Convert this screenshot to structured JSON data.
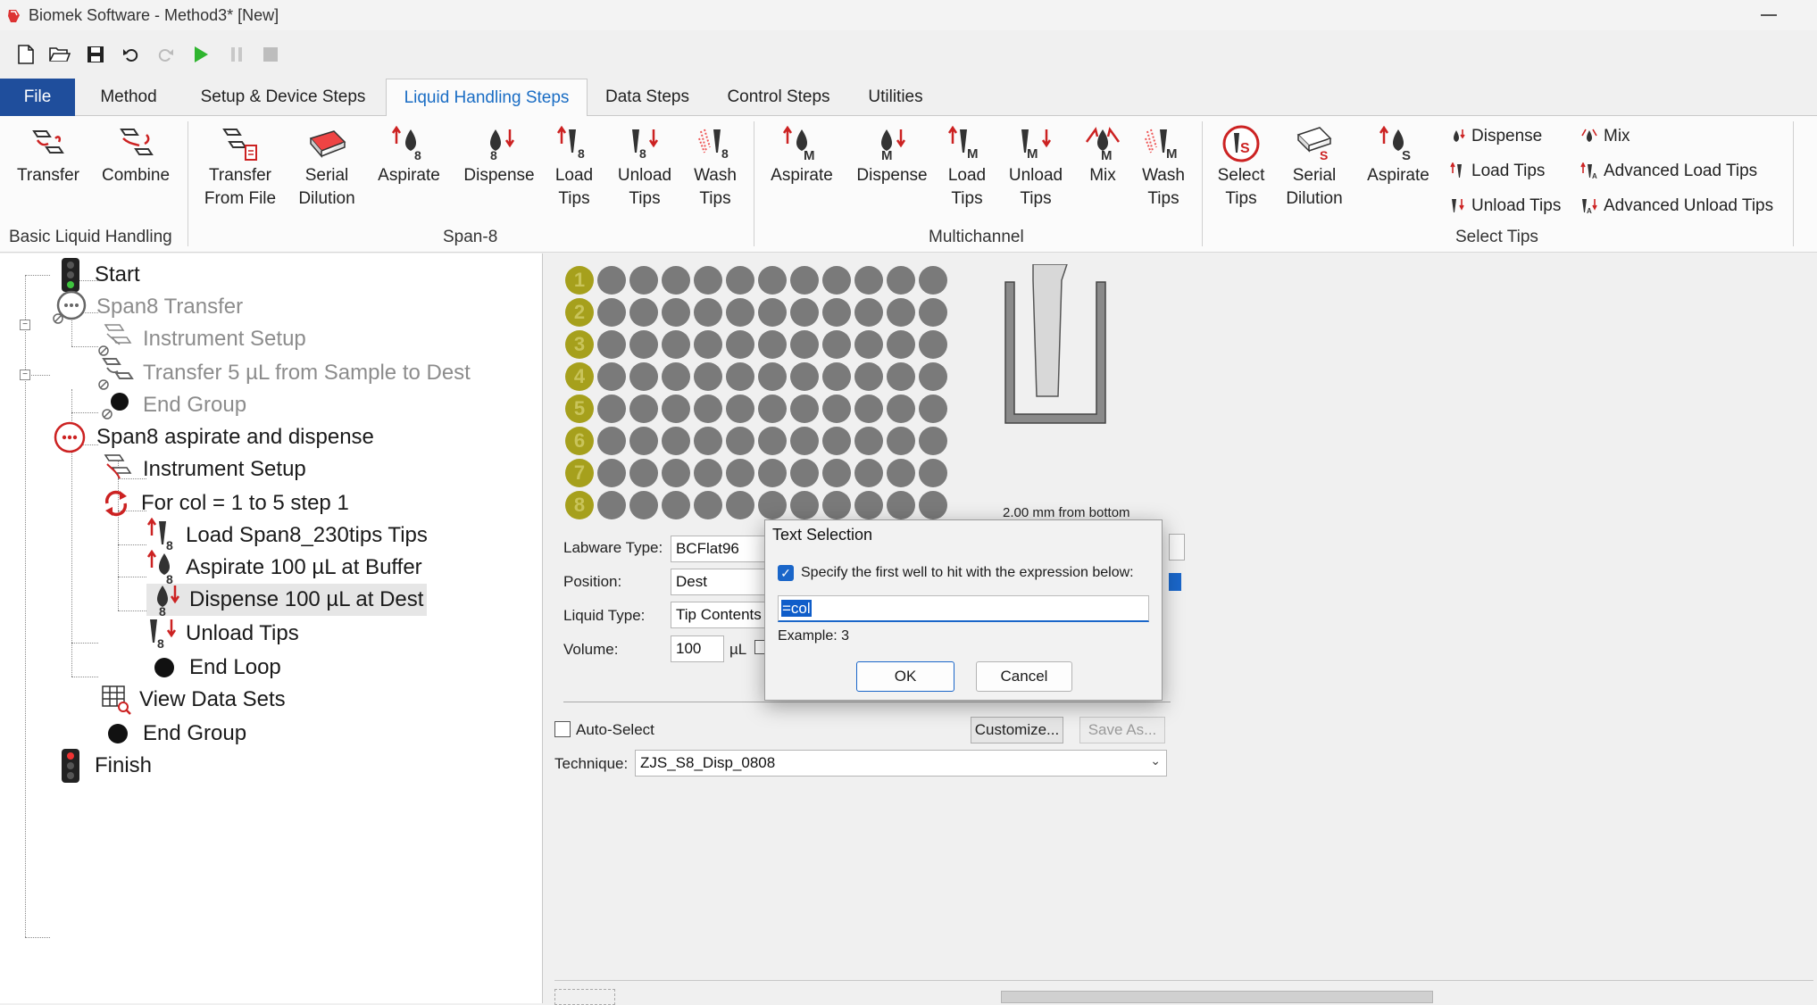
{
  "window": {
    "title": "Biomek Software - Method3* [New]"
  },
  "tabs": [
    {
      "label": "File"
    },
    {
      "label": "Method"
    },
    {
      "label": "Setup & Device Steps"
    },
    {
      "label": "Liquid Handling Steps"
    },
    {
      "label": "Data Steps"
    },
    {
      "label": "Control Steps"
    },
    {
      "label": "Utilities"
    }
  ],
  "ribbon": {
    "basic": {
      "group_label": "Basic Liquid Handling",
      "transfer": "Transfer",
      "combine": "Combine"
    },
    "span8": {
      "group_label": "Span-8",
      "transfer_from_file_1": "Transfer",
      "transfer_from_file_2": "From File",
      "serial_dilution_1": "Serial",
      "serial_dilution_2": "Dilution",
      "aspirate": "Aspirate",
      "dispense": "Dispense",
      "load_tips_1": "Load",
      "load_tips_2": "Tips",
      "unload_tips_1": "Unload",
      "unload_tips_2": "Tips",
      "wash_tips_1": "Wash",
      "wash_tips_2": "Tips"
    },
    "multichannel": {
      "group_label": "Multichannel",
      "aspirate": "Aspirate",
      "dispense": "Dispense",
      "load_tips_1": "Load",
      "load_tips_2": "Tips",
      "unload_tips_1": "Unload",
      "unload_tips_2": "Tips",
      "mix": "Mix",
      "wash_tips_1": "Wash",
      "wash_tips_2": "Tips"
    },
    "select_tips": {
      "group_label": "Select Tips",
      "select_tips_1": "Select",
      "select_tips_2": "Tips",
      "serial_dilution_1": "Serial",
      "serial_dilution_2": "Dilution",
      "aspirate": "Aspirate",
      "dispense": "Dispense",
      "load_tips": "Load Tips",
      "unload_tips": "Unload Tips",
      "mix": "Mix",
      "advanced_load_tips": "Advanced Load Tips",
      "advanced_unload_tips": "Advanced Unload Tips"
    }
  },
  "tree": {
    "start": "Start",
    "span8_transfer": "Span8 Transfer",
    "instrument_setup_1": "Instrument Setup",
    "transfer_step": "Transfer 5 µL from Sample to Dest",
    "end_group_1": "End Group",
    "span8_asp_disp": "Span8 aspirate and dispense",
    "instrument_setup_2": "Instrument Setup",
    "for_loop": "For col = 1 to 5 step 1",
    "load_tips": "Load Span8_230tips Tips",
    "aspirate": "Aspirate 100 µL at Buffer",
    "dispense": "Dispense 100 µL at Dest",
    "unload_tips": "Unload Tips",
    "end_loop": "End Loop",
    "view_data_sets": "View Data Sets",
    "end_group_2": "End Group",
    "finish": "Finish"
  },
  "plate": {
    "row_numbers": [
      "1",
      "2",
      "3",
      "4",
      "5",
      "6",
      "7",
      "8"
    ],
    "highlight_color": "#a6a01c",
    "well_color": "#7a7a7a"
  },
  "tip_view": {
    "caption": "2.00 mm from bottom"
  },
  "form": {
    "labware_type_label": "Labware Type:",
    "labware_type_value": "BCFlat96",
    "position_label": "Position:",
    "position_value": "Dest",
    "liquid_type_label": "Liquid Type:",
    "liquid_type_value": "Tip Contents",
    "volume_label": "Volume:",
    "volume_value": "100",
    "volume_unit": "µL",
    "auto_select_label": "Auto-Select",
    "customize_label": "Customize...",
    "save_as_label": "Save As...",
    "technique_label": "Technique:",
    "technique_value": "ZJS_S8_Disp_0808"
  },
  "dialog": {
    "title": "Text Selection",
    "checkbox_label": "Specify the first well to hit with the expression below:",
    "expression": "=col",
    "example": "Example: 3",
    "ok_label": "OK",
    "cancel_label": "Cancel"
  }
}
